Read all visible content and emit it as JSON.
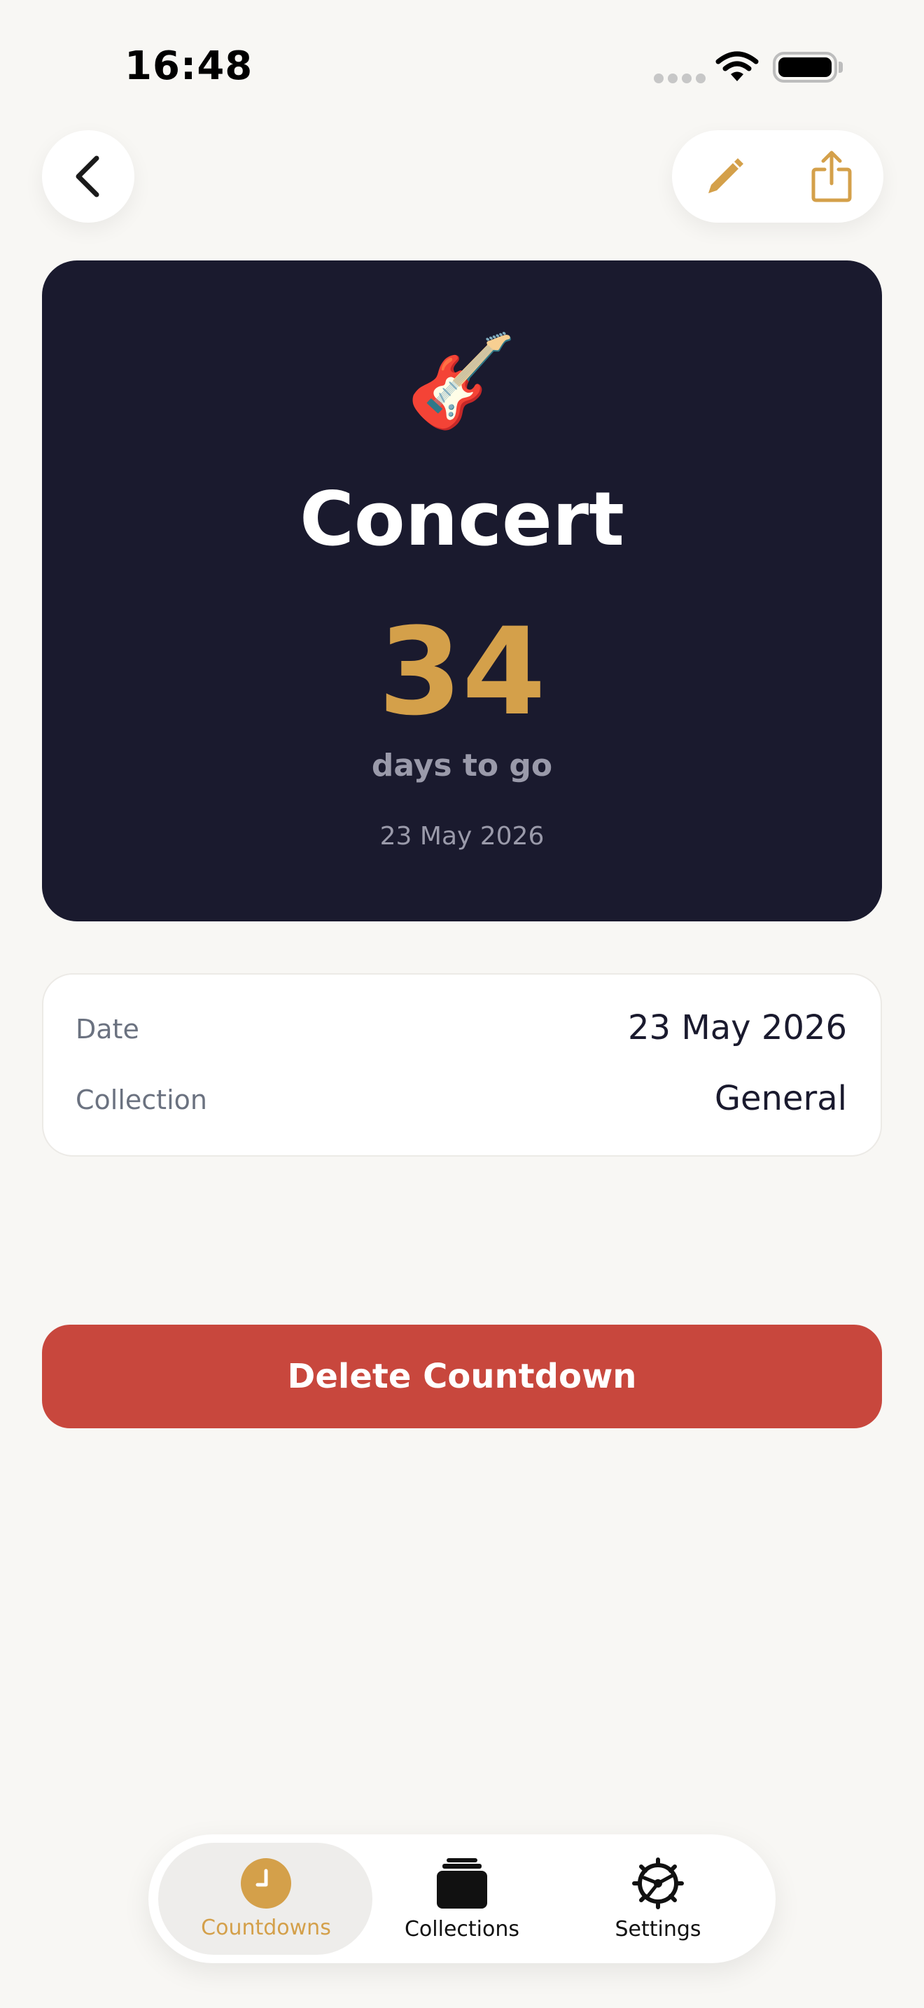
{
  "status_bar": {
    "time": "16:48"
  },
  "header": {
    "back_icon": "chevron-left-icon",
    "edit_icon": "pencil-icon",
    "share_icon": "share-icon"
  },
  "countdown": {
    "emoji": "🎸",
    "title": "Concert",
    "days": "34",
    "subtitle": "days to go",
    "date": "23 May 2026"
  },
  "details": [
    {
      "label": "Date",
      "value": "23 May 2026"
    },
    {
      "label": "Collection",
      "value": "General"
    }
  ],
  "delete_label": "Delete Countdown",
  "tabs": [
    {
      "label": "Countdowns",
      "icon": "clock-icon",
      "active": true
    },
    {
      "label": "Collections",
      "icon": "stack-icon",
      "active": false
    },
    {
      "label": "Settings",
      "icon": "gear-icon",
      "active": false
    }
  ],
  "colors": {
    "accent": "#D4A04A",
    "card_bg": "#1A1A2E",
    "danger": "#C8473D",
    "background": "#F8F7F4"
  }
}
